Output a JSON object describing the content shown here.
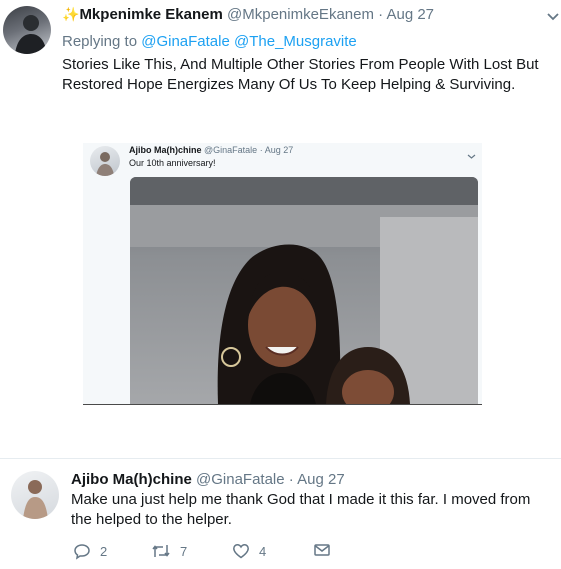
{
  "tweet": {
    "display_name": "Mkpenimke Ekanem",
    "handle": "@MkpenimkeEkanem",
    "sep": "·",
    "date": "Aug 27",
    "replying_to_label": "Replying to",
    "replying_to_users": [
      "@GinaFatale",
      "@The_Musgravite"
    ],
    "text": "Stories Like This, And Multiple Other Stories From People With Lost But Restored Hope Energizes Many Of Us To Keep Helping & Surviving."
  },
  "embedded": {
    "display_name": "Ajibo Ma(h)chine",
    "handle": "@GinaFatale",
    "sep": "·",
    "date": "Aug 27",
    "text": "Our 10th anniversary!"
  },
  "quoted_reply": {
    "display_name": "Ajibo Ma(h)chine",
    "handle": "@GinaFatale",
    "sep": "·",
    "date": "Aug 27",
    "text": "Make una just help me thank God that I made it this far. I moved from the helped to the helper.",
    "actions": {
      "reply_count": "2",
      "retweet_count": "7",
      "like_count": "4"
    }
  },
  "colors": {
    "link": "#1da1f2",
    "muted": "#657786",
    "divider": "#e6ecf0",
    "verified_sparkle": "#9b59d0"
  }
}
